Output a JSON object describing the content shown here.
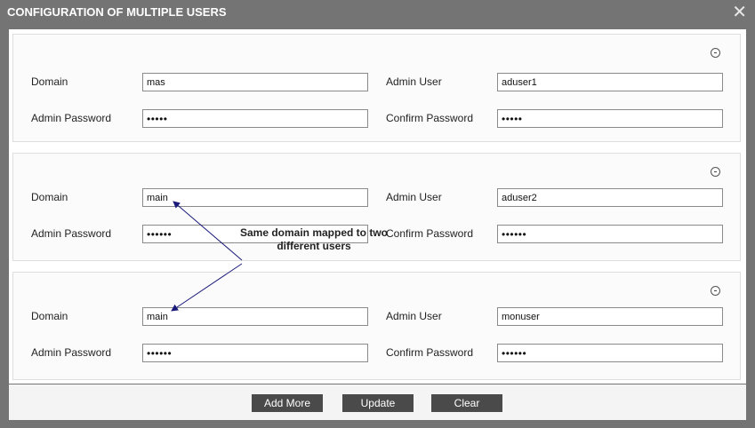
{
  "dialog": {
    "title": "CONFIGURATION OF MULTIPLE USERS",
    "close_glyph": "✕"
  },
  "labels": {
    "domain": "Domain",
    "admin_user": "Admin User",
    "admin_password": "Admin Password",
    "confirm_password": "Confirm Password"
  },
  "users": [
    {
      "domain": "mas",
      "admin_user": "aduser1",
      "admin_password": "•••••",
      "confirm_password": "•••••"
    },
    {
      "domain": "main",
      "admin_user": "aduser2",
      "admin_password": "••••••",
      "confirm_password": "••••••"
    },
    {
      "domain": "main",
      "admin_user": "monuser",
      "admin_password": "••••••",
      "confirm_password": "••••••"
    }
  ],
  "annotation": {
    "text": "Same domain mapped to two different users",
    "color": "#1a1a7a"
  },
  "footer": {
    "add_more": "Add More",
    "update": "Update",
    "clear": "Clear"
  },
  "icons": {
    "close": "close-icon",
    "remove": "minus-circle-icon"
  }
}
